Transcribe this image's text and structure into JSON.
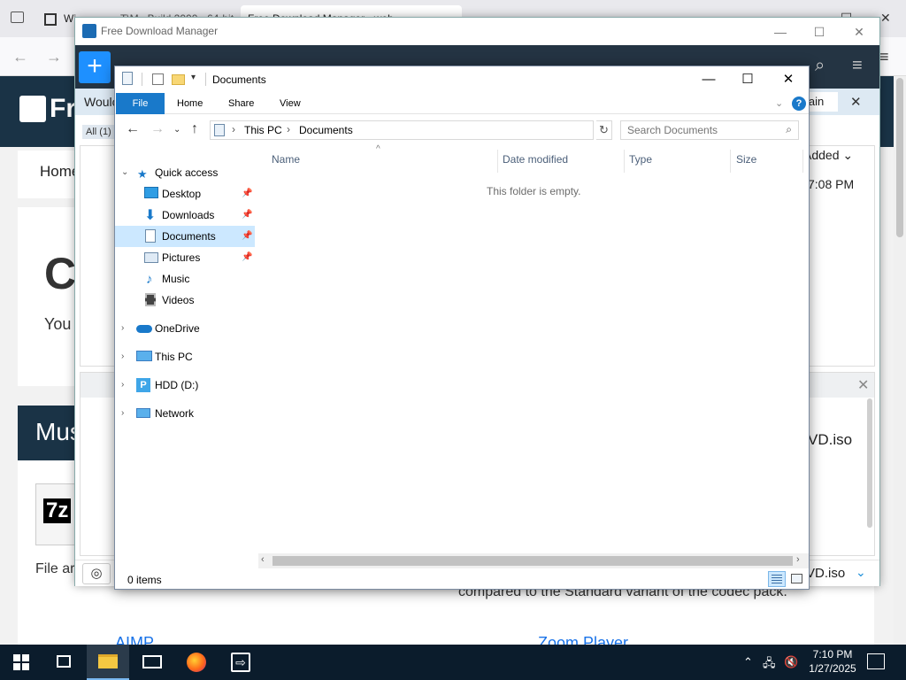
{
  "browser": {
    "tab1": "Wi…",
    "tab2": "T\\M.. Build 2000 - 64-bit",
    "tab3": "Free Download Manager - web...",
    "site_logo": "Fr",
    "breadcrumb_home": "Home",
    "card_title": "Co",
    "card_text": "You",
    "section_title": "Mus",
    "file_arch_text": "File ar",
    "compared_text": "compared to the Standard variant of the codec pack.",
    "aimp_title": "AIMP",
    "zoom_title": "Zoom Player"
  },
  "fdm": {
    "title": "Free Download Manager",
    "notify_text": "Woulc",
    "notify_btn": "jain",
    "filter_all": "All (1)",
    "col_added": "Added ⌄",
    "row_time": "7:08 PM",
    "iso_name_1": "VD.iso",
    "iso_name_2": "VD.iso",
    "add_label": "+"
  },
  "explorer": {
    "title": "Documents",
    "ribbon_tabs": [
      "File",
      "Home",
      "Share",
      "View"
    ],
    "address": {
      "seg1": "This PC",
      "seg2": "Documents"
    },
    "search_placeholder": "Search Documents",
    "nav": {
      "quick_access": "Quick access",
      "desktop": "Desktop",
      "downloads": "Downloads",
      "documents": "Documents",
      "pictures": "Pictures",
      "music": "Music",
      "videos": "Videos",
      "onedrive": "OneDrive",
      "this_pc": "This PC",
      "hdd": "HDD (D:)",
      "network": "Network"
    },
    "columns": {
      "name": "Name",
      "date_modified": "Date modified",
      "type": "Type",
      "size": "Size"
    },
    "empty_message": "This folder is empty.",
    "item_count": "0 items"
  },
  "taskbar": {
    "time": "7:10 PM",
    "date": "1/27/2025"
  },
  "colors": {
    "accent_blue": "#1979ca",
    "selection": "#cce8ff",
    "taskbar": "#0b1c2c",
    "fdm_toolbar": "#243443"
  }
}
